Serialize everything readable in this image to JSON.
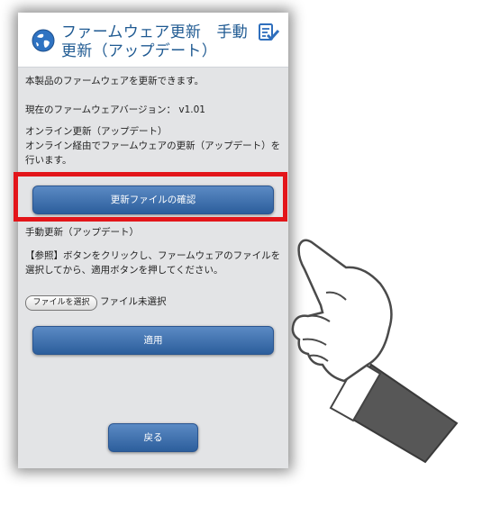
{
  "header": {
    "title": "ファームウェア更新　手動更新（アップデート）"
  },
  "content": {
    "intro": "本製品のファームウェアを更新できます。",
    "current_version": "現在のファームウェアバージョン： v1.01",
    "online_heading": "オンライン更新（アップデート）",
    "online_desc_line1": "オンライン経由でファームウェアの更新（アップデート）を",
    "online_desc_line2": "行います。",
    "check_button": "更新ファイルの確認",
    "manual_heading": "手動更新（アップデート）",
    "manual_desc_line1": "【参照】ボタンをクリックし、ファームウェアのファイルを",
    "manual_desc_line2": "選択してから、適用ボタンを押してください。",
    "file_select_button": "ファイルを選択",
    "file_status": "ファイル未選択",
    "apply_button": "適用",
    "back_button": "戻る"
  },
  "colors": {
    "accent": "#1f5a92",
    "button": "#3b6fb0",
    "highlight": "#e3151a",
    "hand": "#555555"
  }
}
